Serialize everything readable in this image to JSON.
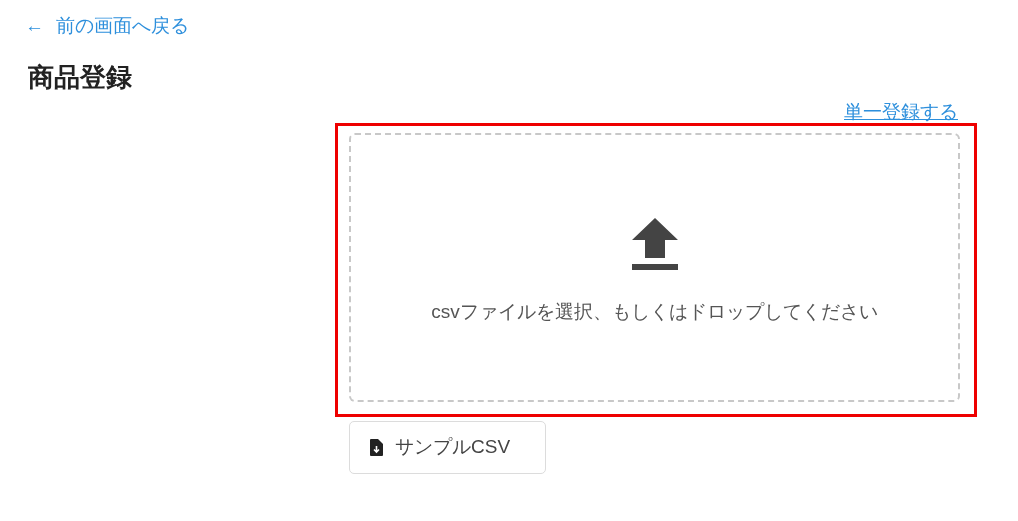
{
  "back_link": {
    "icon": "←",
    "label": "前の画面へ戻る"
  },
  "title": "商品登録",
  "single_register_link": "単一登録する",
  "dropzone": {
    "message": "csvファイルを選択、もしくはドロップしてください"
  },
  "sample_button": "サンプルCSV"
}
